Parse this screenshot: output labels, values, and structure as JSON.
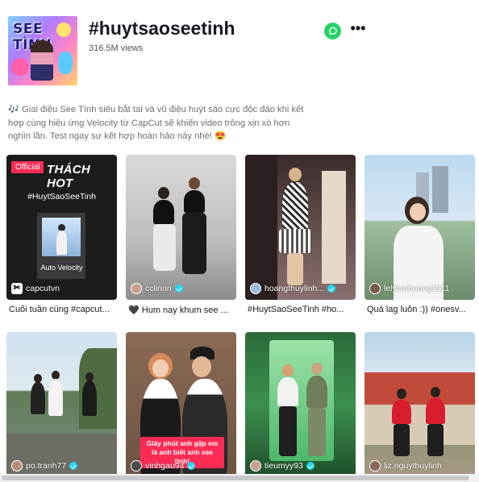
{
  "header": {
    "cover_title": "SEE TÌNH",
    "hashtag": "#huytsaoseetinh",
    "views": "316.5M views",
    "description": "🎶 Giai điệu See Tình siêu bắt tai và vũ điệu huýt sáo cực độc đáo khi kết hợp cùng hiệu ứng Velocity từ CapCut sẽ khiến video trông xịn xò hơn nghìn lần. Test ngay sự kết hợp hoàn hảo này nhé! 😍",
    "share_icon": "whatsapp-icon",
    "more_icon": "more-horizontal-icon"
  },
  "videos": [
    {
      "badge": "Official",
      "overlay_title": "THÁCH HOT",
      "overlay_hashtag": "#HuytSaoSeeTinh",
      "overlay_sub": "Auto Velocity",
      "author": "capcutvn",
      "verified": false,
      "caption": "Cuối tuần cùng #capcut..."
    },
    {
      "author": "cclinnn",
      "verified": true,
      "caption": "🖤 Hum nay khum see ..."
    },
    {
      "author": "hoangthuylinh...",
      "verified": true,
      "caption": "#HuytSaoSeeTinh #ho..."
    },
    {
      "author": "lelylanhuong1911",
      "verified": false,
      "caption": "Quá lag luôn :)) #onesv..."
    },
    {
      "author": "po.tranh77",
      "verified": true,
      "caption": ""
    },
    {
      "overlay_text": "Giây phút anh gặp em là anh biết anh see tình!",
      "author": "vinhgau94",
      "verified": true,
      "caption": ""
    },
    {
      "author": "tieumyy93",
      "verified": true,
      "caption": ""
    },
    {
      "author": "liz.nguythuylinh",
      "verified": false,
      "caption": ""
    }
  ],
  "colors": {
    "accent": "#fe2c55",
    "verified": "#20d5ec",
    "whatsapp": "#25d366"
  }
}
